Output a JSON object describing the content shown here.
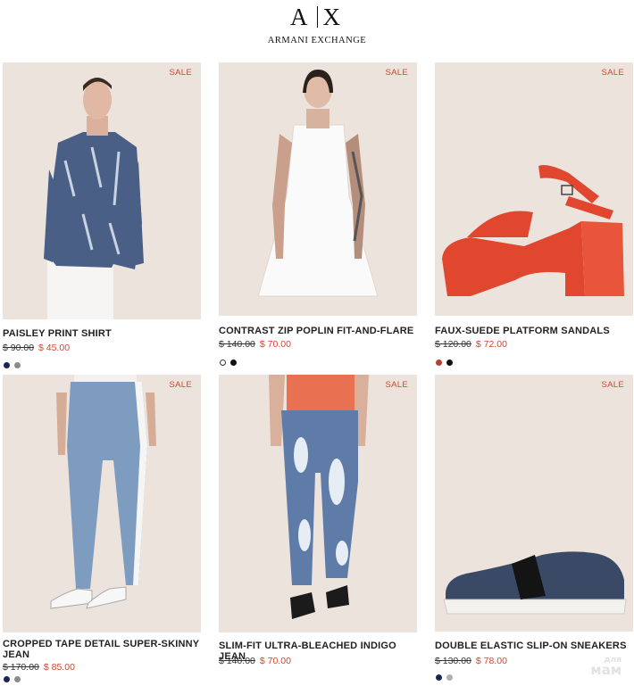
{
  "brand": {
    "mark_left": "A",
    "mark_right": "X",
    "name": "ARMANI EXCHANGE"
  },
  "products": [
    {
      "badge": "SALE",
      "title": "PAISLEY PRINT SHIRT",
      "old_price": "$ 90.00",
      "new_price": "$ 45.00",
      "swatches": [
        "#1d2450",
        "#8a8a8a"
      ]
    },
    {
      "badge": "SALE",
      "title": "CONTRAST ZIP POPLIN FIT-AND-FLARE",
      "old_price": "$ 140.00",
      "new_price": "$ 70.00",
      "swatches": [
        "#ffffff",
        "#111111"
      ]
    },
    {
      "badge": "SALE",
      "title": "FAUX-SUEDE PLATFORM SANDALS",
      "old_price": "$ 120.00",
      "new_price": "$ 72.00",
      "swatches": [
        "#b5412f",
        "#111111"
      ]
    },
    {
      "badge": "SALE",
      "title": "CROPPED TAPE DETAIL SUPER-SKINNY JEAN",
      "old_price": "$ 170.00",
      "new_price": "$ 85.00",
      "swatches": [
        "#1d2450",
        "#8a8a8a"
      ]
    },
    {
      "badge": "SALE",
      "title": "SLIM-FIT ULTRA-BLEACHED INDIGO JEAN",
      "old_price": "$ 140.00",
      "new_price": "$ 70.00",
      "swatches": []
    },
    {
      "badge": "SALE",
      "title": "DOUBLE ELASTIC SLIP-ON SNEAKERS",
      "old_price": "$ 130.00",
      "new_price": "$ 78.00",
      "swatches": [
        "#1d2450",
        "#b0b0b0"
      ]
    }
  ],
  "watermark": {
    "small": "для",
    "big": "мам"
  },
  "colors": {
    "sale_red": "#d2462e",
    "image_bg": "#ede3dd"
  }
}
